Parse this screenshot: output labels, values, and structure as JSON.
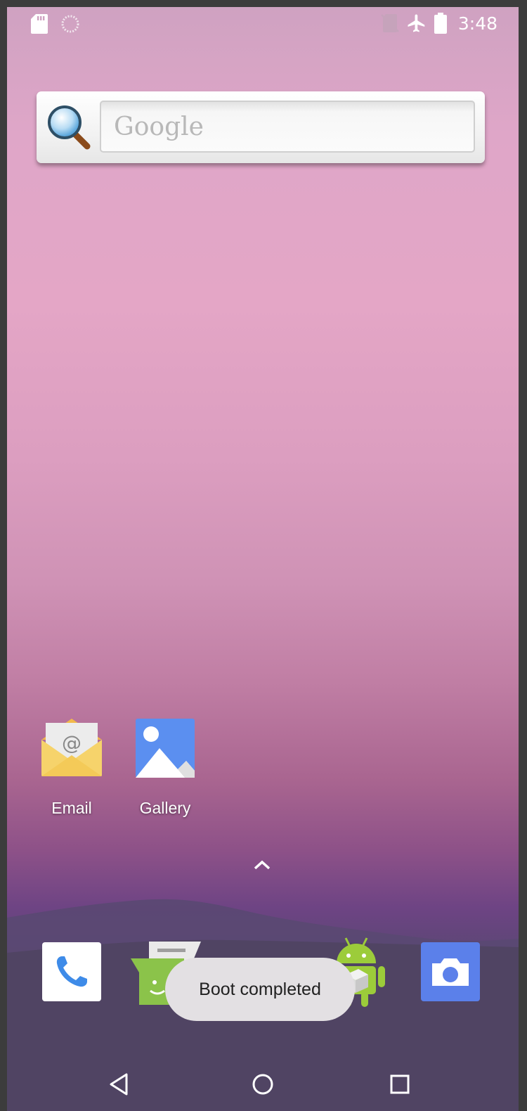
{
  "status_bar": {
    "time": "3:48",
    "left_icons": [
      "sd-card-icon",
      "sync-spinner-icon"
    ],
    "right_icons": [
      "no-sim-icon",
      "airplane-mode-icon",
      "battery-icon"
    ]
  },
  "search_widget": {
    "placeholder": "Google"
  },
  "apps": [
    {
      "label": "Email",
      "icon": "email-icon"
    },
    {
      "label": "Gallery",
      "icon": "gallery-icon"
    }
  ],
  "dock": {
    "items": [
      "phone-icon",
      "messaging-icon",
      "android-app-icon",
      "camera-icon"
    ]
  },
  "toast": {
    "message": "Boot completed"
  },
  "nav_bar": {
    "buttons": [
      "back-icon",
      "home-icon",
      "recents-icon"
    ]
  },
  "colors": {
    "gallery_blue": "#5b8ff0",
    "camera_blue": "#5b80ea",
    "email_yellow": "#f4c95a",
    "messaging_green": "#8bc34a",
    "toast_bg": "#e3e0e3"
  }
}
